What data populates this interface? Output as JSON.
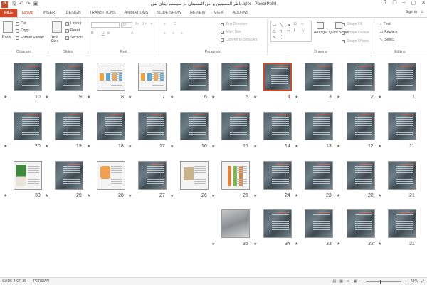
{
  "window": {
    "title": "ناظر المسيتين و آمن المسيتان در سيستم ايقاي يش.pptx - PowerPoint",
    "app_icon": "P",
    "quick_access": [
      "save-icon",
      "undo-icon",
      "redo-icon",
      "present-icon"
    ],
    "controls": [
      "?",
      "❐",
      "–",
      "▢",
      "✕"
    ]
  },
  "tabs": [
    "FILE",
    "HOME",
    "INSERT",
    "DESIGN",
    "TRANSITIONS",
    "ANIMATIONS",
    "SLIDE SHOW",
    "REVIEW",
    "VIEW",
    "ADD-INS"
  ],
  "active_tab": "HOME",
  "signin": "Sign in",
  "ribbon": {
    "clipboard": {
      "label": "Clipboard",
      "paste": "Paste",
      "cut": "Cut",
      "copy": "Copy",
      "format_painter": "Format Painter"
    },
    "slides": {
      "label": "Slides",
      "new_slide": "New Slide",
      "layout": "Layout",
      "reset": "Reset",
      "section": "Section"
    },
    "font": {
      "label": "Font",
      "size": "32"
    },
    "paragraph": {
      "label": "Paragraph",
      "text_direction": "Text Direction",
      "align_text": "Align Text",
      "convert_smartart": "Convert to SmartArt"
    },
    "drawing": {
      "label": "Drawing",
      "arrange": "Arrange",
      "quick_styles": "Quick Styles",
      "shape_fill": "Shape Fill",
      "shape_outline": "Shape Outline",
      "shape_effects": "Shape Effects"
    },
    "editing": {
      "label": "Editing",
      "find": "Find",
      "replace": "Replace",
      "select": "Select"
    }
  },
  "slides": [
    {
      "n": "1"
    },
    {
      "n": "2"
    },
    {
      "n": "3"
    },
    {
      "n": "4"
    },
    {
      "n": "5"
    },
    {
      "n": "6"
    },
    {
      "n": "7"
    },
    {
      "n": "8"
    },
    {
      "n": "9"
    },
    {
      "n": "10"
    },
    {
      "n": "11"
    },
    {
      "n": "12"
    },
    {
      "n": "13"
    },
    {
      "n": "14"
    },
    {
      "n": "15"
    },
    {
      "n": "16"
    },
    {
      "n": "17"
    },
    {
      "n": "18"
    },
    {
      "n": "19"
    },
    {
      "n": "20"
    },
    {
      "n": "21"
    },
    {
      "n": "22"
    },
    {
      "n": "23"
    },
    {
      "n": "24"
    },
    {
      "n": "25"
    },
    {
      "n": "26"
    },
    {
      "n": "27"
    },
    {
      "n": "28"
    },
    {
      "n": "29"
    },
    {
      "n": "30"
    },
    {
      "n": "31"
    },
    {
      "n": "32"
    },
    {
      "n": "33"
    },
    {
      "n": "34"
    },
    {
      "n": "35"
    }
  ],
  "selected_slide": "4",
  "star_glyph": "★",
  "status": {
    "slide_info": "SLIDE 4 OF 35",
    "language": "PERSIAN",
    "zoom": "48%"
  },
  "colors": {
    "accent": "#d24726"
  }
}
